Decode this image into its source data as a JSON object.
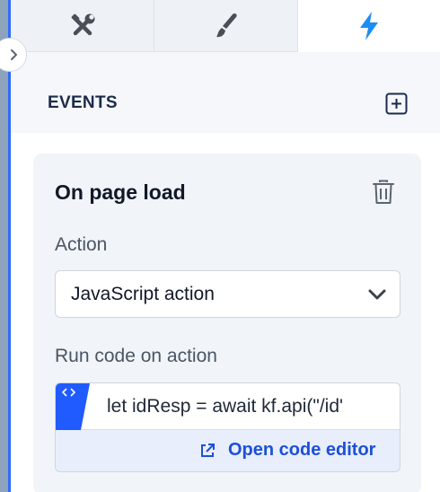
{
  "tabs": [
    {
      "name": "settings",
      "icon": "wrench-screwdriver-icon",
      "active": false
    },
    {
      "name": "style",
      "icon": "paintbrush-icon",
      "active": false
    },
    {
      "name": "events",
      "icon": "lightning-bolt-icon",
      "active": true
    }
  ],
  "events": {
    "title": "EVENTS",
    "add_icon": "add-square-icon"
  },
  "event_card": {
    "title": "On page load",
    "delete_icon": "trash-icon",
    "action_label": "Action",
    "action_value": "JavaScript action",
    "run_label": "Run code on action",
    "code_preview": "let idResp = await kf.api(\"/id'",
    "open_editor_label": "Open code editor"
  },
  "colors": {
    "accent": "#1d4fd8",
    "bolt": "#1d8df5",
    "strip": "#8da3bc",
    "card_bg": "#f1f4f8",
    "code_flag": "#1f5bff"
  }
}
